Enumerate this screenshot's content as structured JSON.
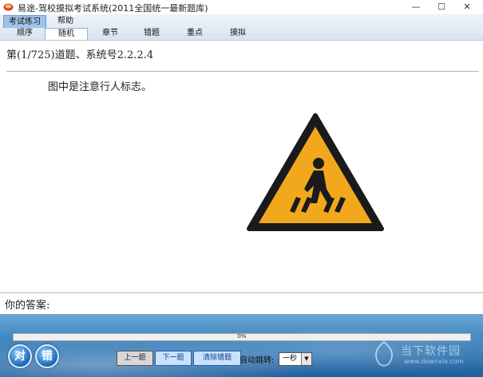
{
  "window": {
    "title": "易途-驾校摸拟考试系统(2011全国统一最新题库)",
    "min_glyph": "—",
    "max_glyph": "☐",
    "close_glyph": "✕"
  },
  "menu": {
    "tabs": [
      "考试练习",
      "帮助"
    ],
    "subtabs": [
      "顺序",
      "随机",
      "章节",
      "错题",
      "重点",
      "摸拟"
    ]
  },
  "question": {
    "header": "第(1/725)道题、系统号2.2.2.4",
    "text": "图中是注意行人标志。",
    "image_icon": "pedestrian-crossing-warning-sign"
  },
  "answer": {
    "label": "你的答案:",
    "value": ""
  },
  "progress": {
    "text": "0%",
    "value": 0
  },
  "controls": {
    "correct_label": "对",
    "wrong_label": "错",
    "prev_label": "上一题",
    "next_label": "下一题",
    "clear_label": "清除错题",
    "auto_jump_label": "自动跳转:",
    "auto_jump_value": "一秒",
    "select_arrow": "▼"
  },
  "watermark": {
    "text": "当下软件园",
    "url": "www.downxia.com"
  },
  "colors": {
    "accent": "#2c74b3",
    "sign_yellow": "#f2a81d",
    "sign_border": "#1a1a1a"
  }
}
